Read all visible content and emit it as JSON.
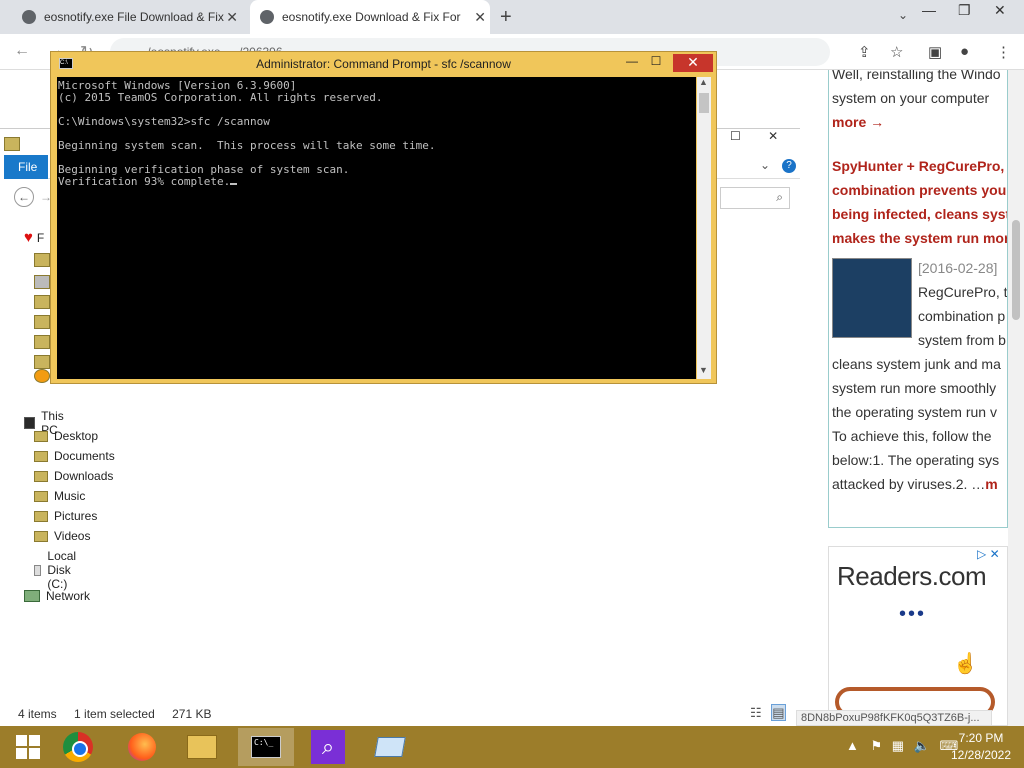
{
  "browser": {
    "tabs": [
      {
        "title": "eosnotify.exe File Download & Fix"
      },
      {
        "title": "eosnotify.exe Download & Fix For"
      }
    ],
    "new_tab": "+",
    "url": "… …/eosnotify.exe … /206396 …"
  },
  "explorer": {
    "file_tab": "File",
    "help": "?",
    "tree": {
      "favorites_initial": "F",
      "this_pc": "This PC",
      "folders": [
        "Desktop",
        "Documents",
        "Downloads",
        "Music",
        "Pictures",
        "Videos"
      ],
      "local_disk": "Local Disk (C:)",
      "network": "Network"
    },
    "status": {
      "items": "4 items",
      "selected": "1 item selected",
      "size": "271 KB"
    }
  },
  "cmd": {
    "title": "Administrator: Command Prompt - sfc  /scannow",
    "app_icon_text": "C:\\",
    "lines": [
      "Microsoft Windows [Version 6.3.9600]",
      "(c) 2015 TeamOS Corporation. All rights reserved.",
      "",
      "C:\\Windows\\system32>sfc /scannow",
      "",
      "Beginning system scan.  This process will take some time.",
      "",
      "Beginning verification phase of system scan.",
      "Verification 93% complete."
    ]
  },
  "web": {
    "line1": "Well, reinstalling the Windo",
    "line2": "system on your computer",
    "more": "more →",
    "headline": [
      "SpyHunter + RegCurePro, t",
      "combination prevents you",
      "being infected, cleans syst",
      "makes the system run mor"
    ],
    "date": "[2016-02-28]",
    "body_side": [
      "RegCurePro, t",
      "combination p",
      "system from b"
    ],
    "body": [
      "cleans system junk and ma",
      "system run more smoothly",
      "the operating system run v",
      "To achieve this, follow the",
      "below:1. The operating sys",
      "attacked by viruses.2.  …"
    ],
    "body_more": "m",
    "ad_logo": "Readers.com",
    "ad_dots": "•••",
    "status_url": "8DN8bPoxuP98fKFK0q5Q3TZ6B-j..."
  },
  "taskbar": {
    "time": "7:20 PM",
    "date": "12/28/2022"
  }
}
